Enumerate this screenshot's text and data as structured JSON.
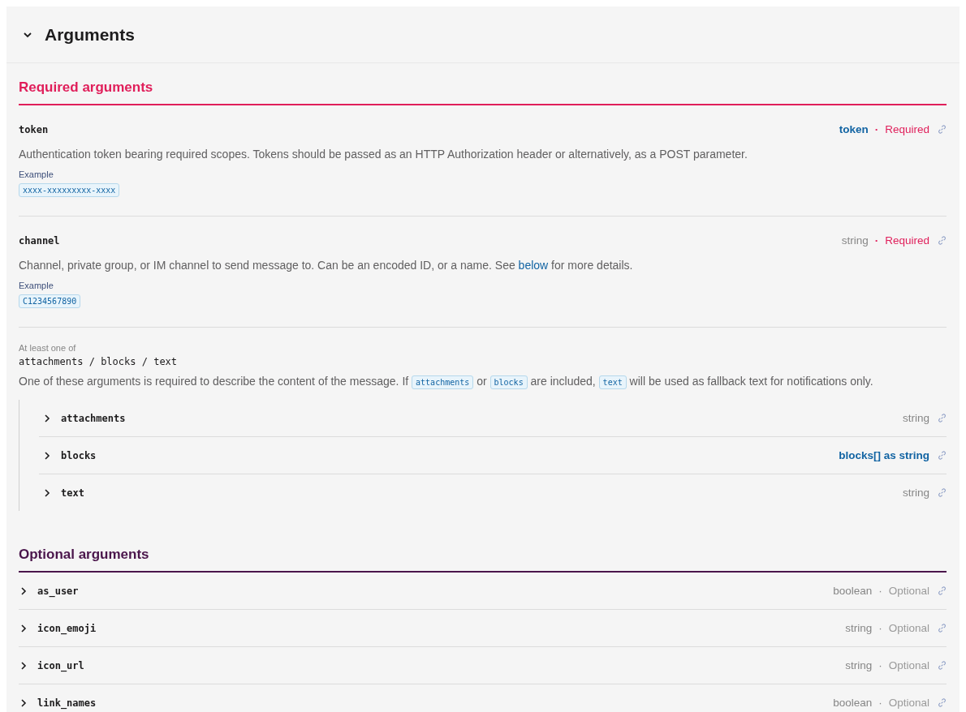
{
  "section": {
    "title": "Arguments",
    "expanded": true
  },
  "required": {
    "heading": "Required arguments",
    "args": [
      {
        "name": "token",
        "type": "token",
        "type_link": true,
        "dot": "·",
        "requirement": "Required",
        "required": true,
        "description": [
          {
            "kind": "text",
            "text": "Authentication token bearing required scopes. Tokens should be passed as an HTTP Authorization header or alternatively, as a POST parameter."
          }
        ],
        "example_label": "Example",
        "example": "xxxx-xxxxxxxxx-xxxx"
      },
      {
        "name": "channel",
        "type": "string",
        "type_link": false,
        "dot": "·",
        "requirement": "Required",
        "required": true,
        "description": [
          {
            "kind": "text",
            "text": "Channel, private group, or IM channel to send message to. Can be an encoded ID, or a name. See "
          },
          {
            "kind": "link",
            "text": "below"
          },
          {
            "kind": "text",
            "text": " for more details."
          }
        ],
        "example_label": "Example",
        "example": "C1234567890"
      }
    ],
    "group": {
      "label": "At least one of",
      "names": "attachments / blocks / text",
      "description": [
        {
          "kind": "text",
          "text": "One of these arguments is required to describe the content of the message. If "
        },
        {
          "kind": "code",
          "text": "attachments"
        },
        {
          "kind": "text",
          "text": " or "
        },
        {
          "kind": "code",
          "text": "blocks"
        },
        {
          "kind": "text",
          "text": " are included, "
        },
        {
          "kind": "code",
          "text": "text"
        },
        {
          "kind": "text",
          "text": " will be used as fallback text for notifications only."
        }
      ],
      "args": [
        {
          "name": "attachments",
          "type": "string",
          "type_link": false,
          "expanded": false
        },
        {
          "name": "blocks",
          "type": "blocks[] as string",
          "type_link": true,
          "expanded": false
        },
        {
          "name": "text",
          "type": "string",
          "type_link": false,
          "expanded": false
        }
      ]
    }
  },
  "optional": {
    "heading": "Optional arguments",
    "args": [
      {
        "name": "as_user",
        "type": "boolean",
        "type_link": false,
        "dot": "·",
        "requirement": "Optional",
        "required": false,
        "expanded": false
      },
      {
        "name": "icon_emoji",
        "type": "string",
        "type_link": false,
        "dot": "·",
        "requirement": "Optional",
        "required": false,
        "expanded": false
      },
      {
        "name": "icon_url",
        "type": "string",
        "type_link": false,
        "dot": "·",
        "requirement": "Optional",
        "required": false,
        "expanded": false
      },
      {
        "name": "link_names",
        "type": "boolean",
        "type_link": false,
        "dot": "·",
        "requirement": "Optional",
        "required": false,
        "expanded": false
      }
    ]
  }
}
